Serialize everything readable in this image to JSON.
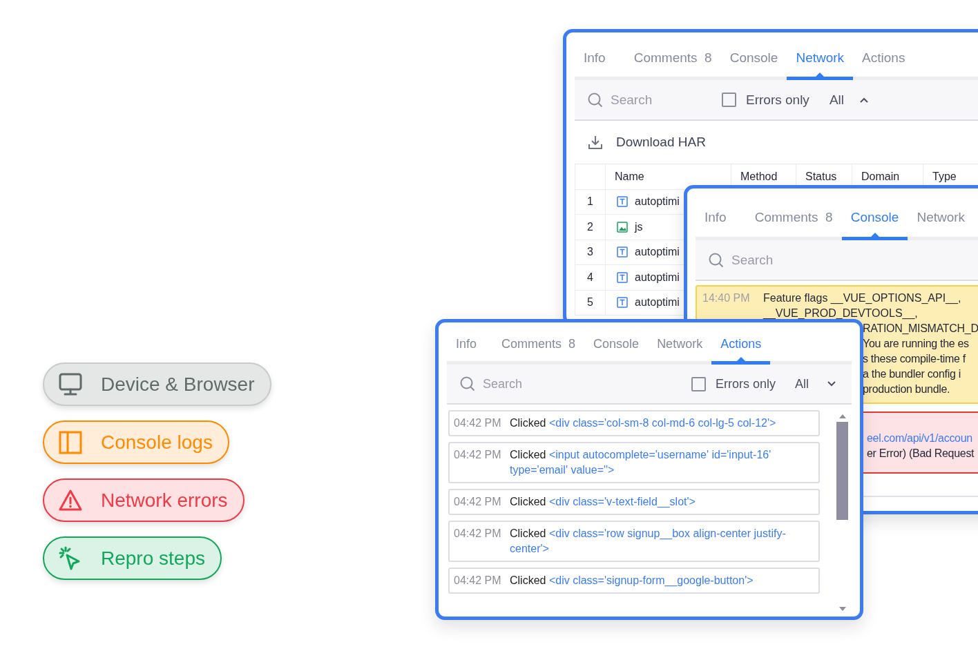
{
  "badges": [
    {
      "kind": "monitor",
      "label": "Device & Browser",
      "color": "#5f6b69"
    },
    {
      "kind": "panel",
      "label": "Console logs",
      "color": "#ff8a00"
    },
    {
      "kind": "warning",
      "label": "Network errors",
      "color": "#f03a46"
    },
    {
      "kind": "cursor",
      "label": "Repro steps",
      "color": "#12a85c"
    }
  ],
  "network_panel": {
    "tabs": [
      {
        "label": "Info",
        "selected": false
      },
      {
        "label": "Comments",
        "count": "8",
        "selected": false
      },
      {
        "label": "Console",
        "selected": false
      },
      {
        "label": "Network",
        "selected": true
      },
      {
        "label": "Actions",
        "selected": false
      }
    ],
    "search": {
      "placeholder": "Search"
    },
    "errors_only": {
      "label": "Errors only",
      "checked": false
    },
    "filter": "All",
    "download": "Download HAR",
    "table": {
      "columns": [
        "Name",
        "Method",
        "Status",
        "Domain",
        "Type"
      ],
      "rows": [
        {
          "index": "1",
          "kind": "text",
          "name": "autoptimi"
        },
        {
          "index": "2",
          "kind": "image",
          "name": "js"
        },
        {
          "index": "3",
          "kind": "text",
          "name": "autoptimi"
        },
        {
          "index": "4",
          "kind": "text",
          "name": "autoptimi"
        },
        {
          "index": "5",
          "kind": "text",
          "name": "autoptimi"
        }
      ]
    }
  },
  "console_panel": {
    "tabs": [
      {
        "label": "Info",
        "selected": false
      },
      {
        "label": "Comments",
        "count": "8",
        "selected": false
      },
      {
        "label": "Console",
        "selected": true
      },
      {
        "label": "Network",
        "selected": false
      }
    ],
    "search": {
      "placeholder": "Search"
    },
    "entries": [
      {
        "kind": "warning",
        "time": "14:40 PM",
        "lines": [
          "Feature flags __VUE_OPTIONS_API__,",
          "__VUE_PROD_DEVTOOLS__,"
        ],
        "covered_lines": [
          "RATION_MISMATCH_D",
          "You are running the es",
          "s these compile-time f",
          "a the bundler config i",
          "production bundle."
        ]
      },
      {
        "kind": "error",
        "link": "eel.com/api/v1/accoun",
        "covered_lines": [
          "er Error) (Bad Request"
        ]
      },
      {
        "kind": "plain"
      }
    ]
  },
  "actions_panel": {
    "tabs": [
      {
        "label": "Info",
        "selected": false
      },
      {
        "label": "Comments",
        "count": "8",
        "selected": false
      },
      {
        "label": "Console",
        "selected": false
      },
      {
        "label": "Network",
        "selected": false
      },
      {
        "label": "Actions",
        "selected": true
      }
    ],
    "search": {
      "placeholder": "Search"
    },
    "errors_only": {
      "label": "Errors only",
      "checked": false
    },
    "filter": "All",
    "entries": [
      {
        "time": "04:42 PM",
        "action": "Clicked",
        "target": "<div class='col-sm-8 col-md-6 col-lg-5 col-12'>"
      },
      {
        "time": "04:42 PM",
        "action": "Clicked",
        "target": "<input autocomplete='username' id='input-16' type='email' value=''>"
      },
      {
        "time": "04:42 PM",
        "action": "Clicked",
        "target": "<div class='v-text-field__slot'>"
      },
      {
        "time": "04:42 PM",
        "action": "Clicked",
        "target": "<div class='row signup__box align-center justify-center'>"
      },
      {
        "time": "04:42 PM",
        "action": "Clicked",
        "target": "<div class='signup-form__google-button'>"
      }
    ]
  }
}
